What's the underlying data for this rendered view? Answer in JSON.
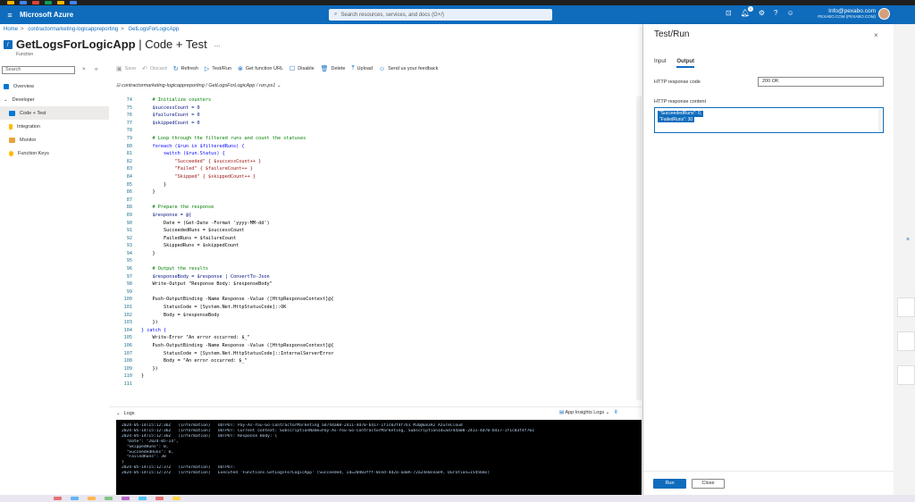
{
  "header": {
    "brand": "Microsoft Azure",
    "search_placeholder": "Search resources, services, and docs (G+/)",
    "notification_count": "1",
    "account_email": "Info@pexabo.com",
    "account_org": "PEXABO.COM (PEXABO.COM)"
  },
  "breadcrumb": [
    "Home",
    "contractormarketing-logicappreporting",
    "GetLogsForLogicApp"
  ],
  "title": {
    "name": "GetLogsForLogicApp",
    "suffix": " | Code + Test",
    "ellipsis": "...",
    "subtitle": "Function"
  },
  "leftnav": {
    "search_placeholder": "Search",
    "items": [
      {
        "label": "Overview"
      },
      {
        "label": "Developer"
      },
      {
        "label": "Code + Test"
      },
      {
        "label": "Integration"
      },
      {
        "label": "Monitor"
      },
      {
        "label": "Function Keys"
      }
    ],
    "colors": [
      "#0078d4",
      "#0078d4",
      "#0078d4",
      "#ffb900",
      "#e8a33d",
      "#ffb900"
    ]
  },
  "toolbar": {
    "save": "Save",
    "discard": "Discard",
    "refresh": "Refresh",
    "test_run": "Test/Run",
    "get_url": "Get function URL",
    "disable": "Disable",
    "delete": "Delete",
    "upload": "Upload",
    "feedback": "Send us your feedback"
  },
  "filepath": "contractormarketing-logicappreporting / GetLogsForLogicApp / run.ps1",
  "editor": {
    "lines": [
      {
        "n": "74",
        "t": "    # Initialize counters",
        "c": "comment"
      },
      {
        "n": "75",
        "t": "    $successCount = 0",
        "c": "var"
      },
      {
        "n": "76",
        "t": "    $failureCount = 0",
        "c": "var"
      },
      {
        "n": "77",
        "t": "    $skippedCount = 0",
        "c": "var"
      },
      {
        "n": "78",
        "t": "",
        "c": "plain"
      },
      {
        "n": "79",
        "t": "    # Loop through the filtered runs and count the statuses",
        "c": "comment"
      },
      {
        "n": "80",
        "t": "    foreach ($run in $filteredRuns) {",
        "c": "kw"
      },
      {
        "n": "81",
        "t": "        switch ($run.Status) {",
        "c": "kw"
      },
      {
        "n": "82",
        "t": "            \"Succeeded\" { $successCount++ }",
        "c": "str"
      },
      {
        "n": "83",
        "t": "            \"Failed\" { $failureCount++ }",
        "c": "str"
      },
      {
        "n": "84",
        "t": "            \"Skipped\" { $skippedCount++ }",
        "c": "str"
      },
      {
        "n": "85",
        "t": "        }",
        "c": "plain"
      },
      {
        "n": "86",
        "t": "    }",
        "c": "plain"
      },
      {
        "n": "87",
        "t": "",
        "c": "plain"
      },
      {
        "n": "88",
        "t": "    # Prepare the response",
        "c": "comment"
      },
      {
        "n": "89",
        "t": "    $response = @{",
        "c": "var"
      },
      {
        "n": "90",
        "t": "        Date = (Get-Date -Format 'yyyy-MM-dd')",
        "c": "plain"
      },
      {
        "n": "91",
        "t": "        SucceededRuns = $successCount",
        "c": "plain"
      },
      {
        "n": "92",
        "t": "        FailedRuns = $failureCount",
        "c": "plain"
      },
      {
        "n": "93",
        "t": "        SkippedRuns = $skippedCount",
        "c": "plain"
      },
      {
        "n": "94",
        "t": "    }",
        "c": "plain"
      },
      {
        "n": "95",
        "t": "",
        "c": "plain"
      },
      {
        "n": "96",
        "t": "    # Output the results",
        "c": "comment"
      },
      {
        "n": "97",
        "t": "    $responseBody = $response | ConvertTo-Json",
        "c": "var"
      },
      {
        "n": "98",
        "t": "    Write-Output \"Response Body: $responseBody\"",
        "c": "plain"
      },
      {
        "n": "99",
        "t": "",
        "c": "plain"
      },
      {
        "n": "100",
        "t": "    Push-OutputBinding -Name Response -Value ([HttpResponseContext]@{",
        "c": "plain"
      },
      {
        "n": "101",
        "t": "        StatusCode = [System.Net.HttpStatusCode]::OK",
        "c": "plain"
      },
      {
        "n": "102",
        "t": "        Body = $responseBody",
        "c": "plain"
      },
      {
        "n": "103",
        "t": "    })",
        "c": "plain"
      },
      {
        "n": "104",
        "t": "} catch {",
        "c": "kw"
      },
      {
        "n": "105",
        "t": "    Write-Error \"An error occurred: $_\"",
        "c": "plain"
      },
      {
        "n": "106",
        "t": "    Push-OutputBinding -Name Response -Value ([HttpResponseContext]@{",
        "c": "plain"
      },
      {
        "n": "107",
        "t": "        StatusCode = [System.Net.HttpStatusCode]::InternalServerError",
        "c": "plain"
      },
      {
        "n": "108",
        "t": "        Body = \"An error occurred: $_\"",
        "c": "plain"
      },
      {
        "n": "109",
        "t": "    })",
        "c": "plain"
      },
      {
        "n": "110",
        "t": "}",
        "c": "plain"
      },
      {
        "n": "111",
        "t": "",
        "c": "plain"
      }
    ]
  },
  "logs": {
    "label": "Logs",
    "app_insights": "App Insights Logs",
    "lines": [
      "2024-05-14T15:12:36Z   [Information]   OUTPUT: Pay-As-You-Go-ContractorMarketing ad744a08-2411-4d70-b417-1f1c03f4f761 M3Q@E83A2 AzureCloud",
      "2024-05-14T15:12:36Z   [Information]   OUTPUT: Current context: SubscriptionName=Pay-As-You-Go-ContractorMarketing, SubscriptionId=ad744a08-2411-4d70-b417-1f1c03f4f761",
      "2024-05-14T15:12:36Z   [Information]   OUTPUT: Response Body: {",
      "  \"Date\": \"2024-05-14\",",
      "  \"SkippedRuns\": 0,",
      "  \"SucceededRuns\": 0,",
      "  \"FailedRuns\": 30",
      "}",
      "2024-05-14T15:12:37Z   [Information]   OUTPUT:",
      "2024-05-14T15:12:37Z   [Information]   Executed 'Functions.GetLogsForLogicApp' (Succeeded, Id=20403fff-0ced-4d2a-aa0A-72a24e0ceae9, Duration=15456ms)"
    ]
  },
  "panel": {
    "title": "Test/Run",
    "tab_input": "Input",
    "tab_output": "Output",
    "label_code": "HTTP response code",
    "code_value": "200 OK",
    "label_content": "HTTP response content",
    "content_line1": "\"SucceededRuns\": 0,",
    "content_line2": "\"FailedRuns\": 30",
    "run": "Run",
    "close": "Close"
  },
  "colors": {
    "accent": "#0f6cbd",
    "comment": "#008000",
    "string": "#a31515",
    "keyword": "#0000ff",
    "variable": "#001080"
  }
}
